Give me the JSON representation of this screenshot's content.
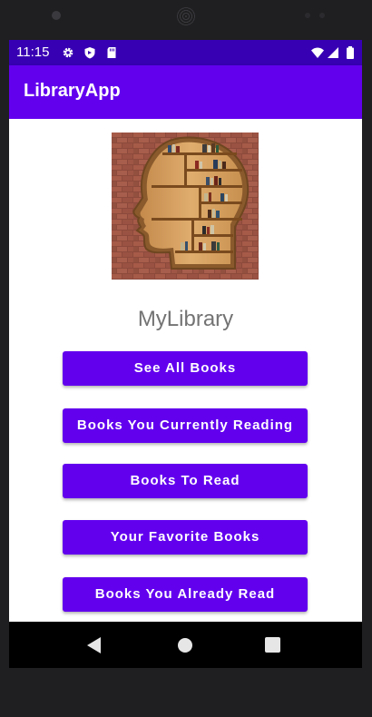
{
  "status_bar": {
    "time": "11:15",
    "left_icons": [
      "gear-icon",
      "shield-icon",
      "sd-card-icon"
    ],
    "right_icons": [
      "wifi-icon",
      "cell-signal-icon",
      "battery-icon"
    ],
    "background_color": "#3700b3"
  },
  "app_bar": {
    "title": "LibraryApp",
    "background_color": "#6200ee"
  },
  "main": {
    "logo_icon": "bookshelf-head-logo",
    "heading": "MyLibrary",
    "buttons": [
      {
        "label": "See All Books"
      },
      {
        "label": "Books You Currently Reading"
      },
      {
        "label": "Books To Read"
      },
      {
        "label": "Your Favorite Books"
      },
      {
        "label": "Books You Already Read"
      }
    ],
    "button_color": "#6200ee"
  },
  "nav_bar": {
    "icons": [
      "back-icon",
      "home-icon",
      "recents-icon"
    ]
  }
}
